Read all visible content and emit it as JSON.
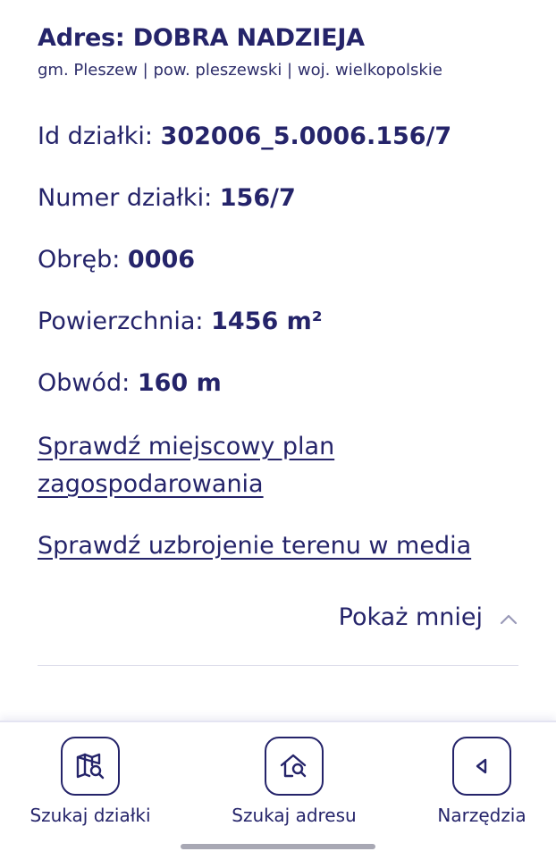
{
  "address": {
    "title": "Adres: DOBRA NADZIEJA",
    "subtitle": "gm. Pleszew | pow. pleszewski | woj. wielkopolskie"
  },
  "details": {
    "id": {
      "label": "Id działki: ",
      "value": "302006_5.0006.156/7"
    },
    "number": {
      "label": "Numer działki: ",
      "value": "156/7"
    },
    "precinct": {
      "label": "Obręb: ",
      "value": "0006"
    },
    "area": {
      "label": "Powierzchnia: ",
      "value": "1456 m²"
    },
    "perimeter": {
      "label": "Obwód: ",
      "value": "160 m"
    }
  },
  "links": {
    "plan": "Sprawdź miejscowy plan zagospodarowania",
    "utilities": "Sprawdź uzbrojenie terenu w media"
  },
  "toggle": {
    "label": "Pokaż mniej",
    "icon": "chevron-up-icon"
  },
  "nav": [
    {
      "label": "Szukaj działki",
      "icon": "map-search-icon"
    },
    {
      "label": "Szukaj adresu",
      "icon": "home-search-icon"
    },
    {
      "label": "Narzędzia",
      "icon": "chevron-left-icon"
    }
  ],
  "colors": {
    "primary": "#25246a",
    "divider": "#dcdcea"
  }
}
